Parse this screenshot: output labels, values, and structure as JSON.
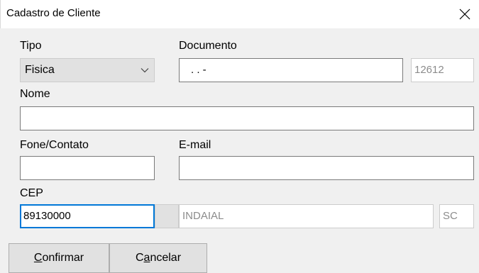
{
  "window": {
    "title": "Cadastro de Cliente",
    "close_symbol": "✕"
  },
  "form": {
    "tipo": {
      "label": "Tipo",
      "selected": "Fisica",
      "icon": "chevron-down-icon"
    },
    "documento": {
      "label": "Documento",
      "value": ". . -",
      "code": "12612"
    },
    "nome": {
      "label": "Nome",
      "value": ""
    },
    "fone": {
      "label": "Fone/Contato",
      "value": ""
    },
    "email": {
      "label": "E-mail",
      "value": ""
    },
    "cep": {
      "label": "CEP",
      "value": "89130000",
      "cidade": "INDAIAL",
      "uf": "SC"
    }
  },
  "buttons": {
    "confirmar": {
      "mnemonic": "C",
      "rest": "onfirmar"
    },
    "cancelar": {
      "start": "C",
      "mnemonic": "a",
      "rest": "ncelar"
    }
  },
  "colors": {
    "focus": "#0078d7",
    "background": "#f0f0f0"
  }
}
